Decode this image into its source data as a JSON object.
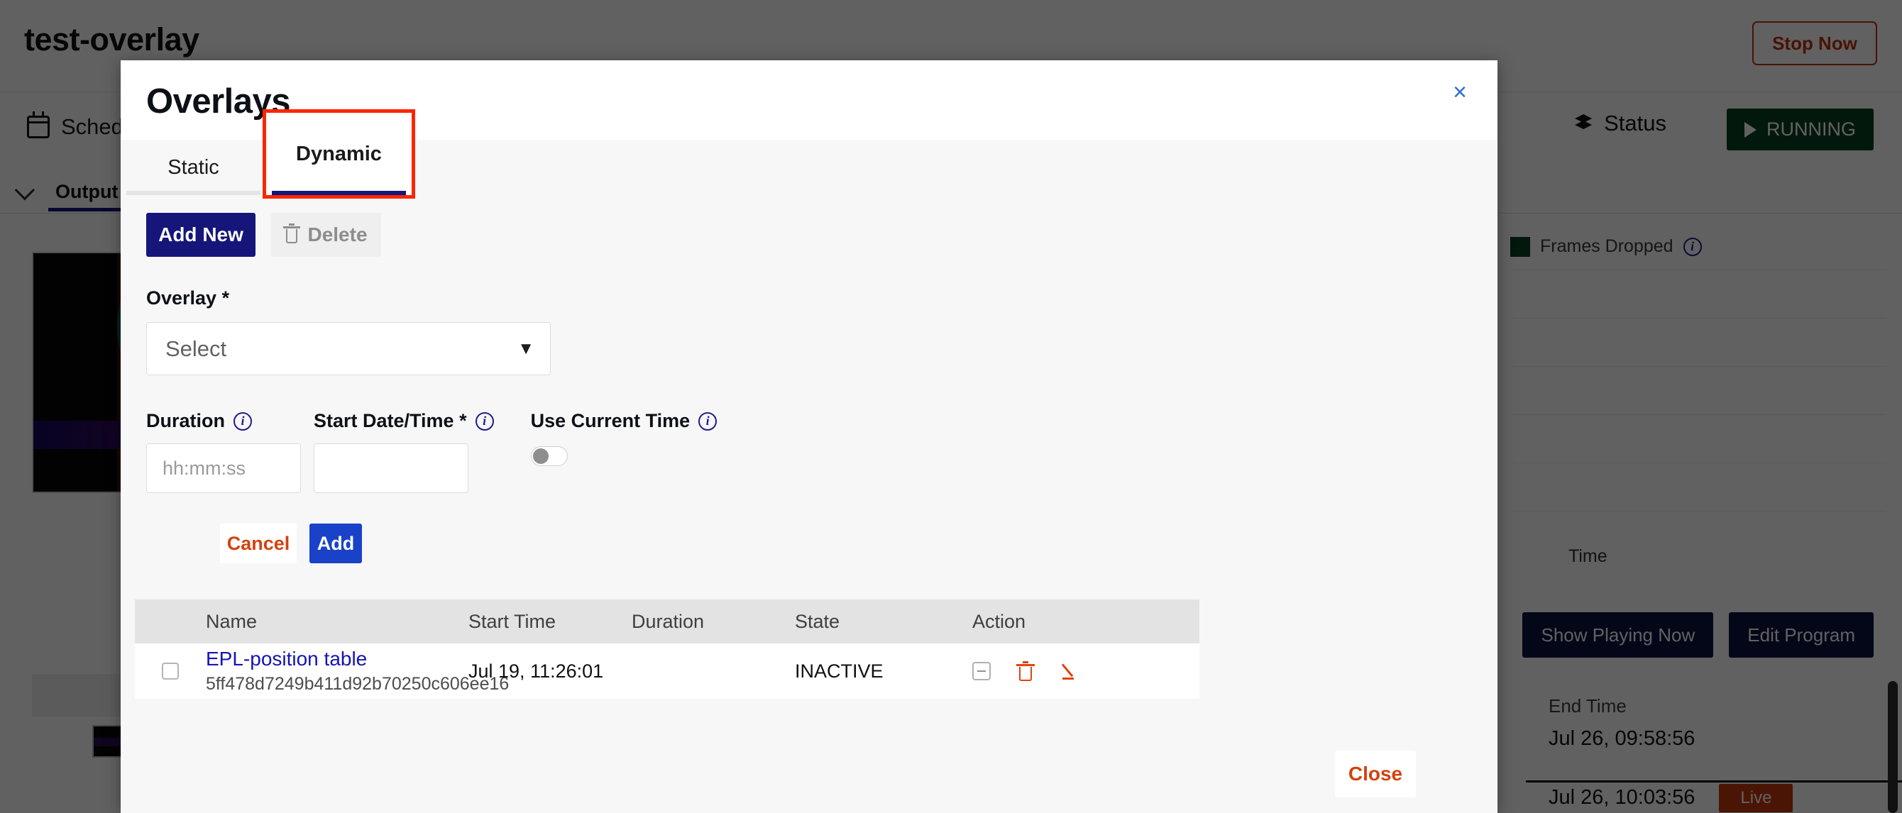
{
  "background": {
    "page_title": "test-overlay",
    "stop_now_label": "Stop Now",
    "schedule_label": "Schedule",
    "status_label": "Status",
    "running_label": "RUNNING",
    "tab_output": "Output",
    "legend_frames_dropped": "Frames Dropped",
    "time_axis_label": "Time",
    "buttons": {
      "show_playing_now": "Show Playing Now",
      "edit_program": "Edit Program"
    },
    "end_time_label": "End Time",
    "end_time_value": "Jul 26, 09:58:56",
    "live_time_value": "Jul 26, 10:03:56",
    "live_badge": "Live"
  },
  "modal": {
    "title": "Overlays",
    "close_icon": "×",
    "tabs": [
      {
        "label": "Static",
        "active": false
      },
      {
        "label": "Dynamic",
        "active": true
      }
    ],
    "toolbar": {
      "add_new_label": "Add New",
      "delete_label": "Delete"
    },
    "form": {
      "overlay_label": "Overlay *",
      "overlay_selected": "Select",
      "overlay_caret": "▼",
      "duration_label": "Duration",
      "duration_placeholder": "hh:mm:ss",
      "duration_value": "",
      "start_datetime_label": "Start Date/Time *",
      "start_datetime_value": "",
      "use_current_time_label": "Use Current Time",
      "use_current_time_on": false,
      "cancel_label": "Cancel",
      "add_label": "Add"
    },
    "table": {
      "columns": [
        "Name",
        "Start Time",
        "Duration",
        "State",
        "Action"
      ],
      "rows": [
        {
          "name": "EPL-position table",
          "id": "5ff478d7249b411d92b70250c606ee16",
          "start_time": "Jul 19, 11:26:01",
          "duration": "",
          "state": "INACTIVE"
        }
      ]
    },
    "footer": {
      "close_label": "Close"
    }
  },
  "colors": {
    "primary_navy": "#15157a",
    "accent_blue": "#1a42c8",
    "danger_orange": "#d3420d",
    "highlight_red": "#fb2600",
    "running_green": "#0a4020"
  }
}
